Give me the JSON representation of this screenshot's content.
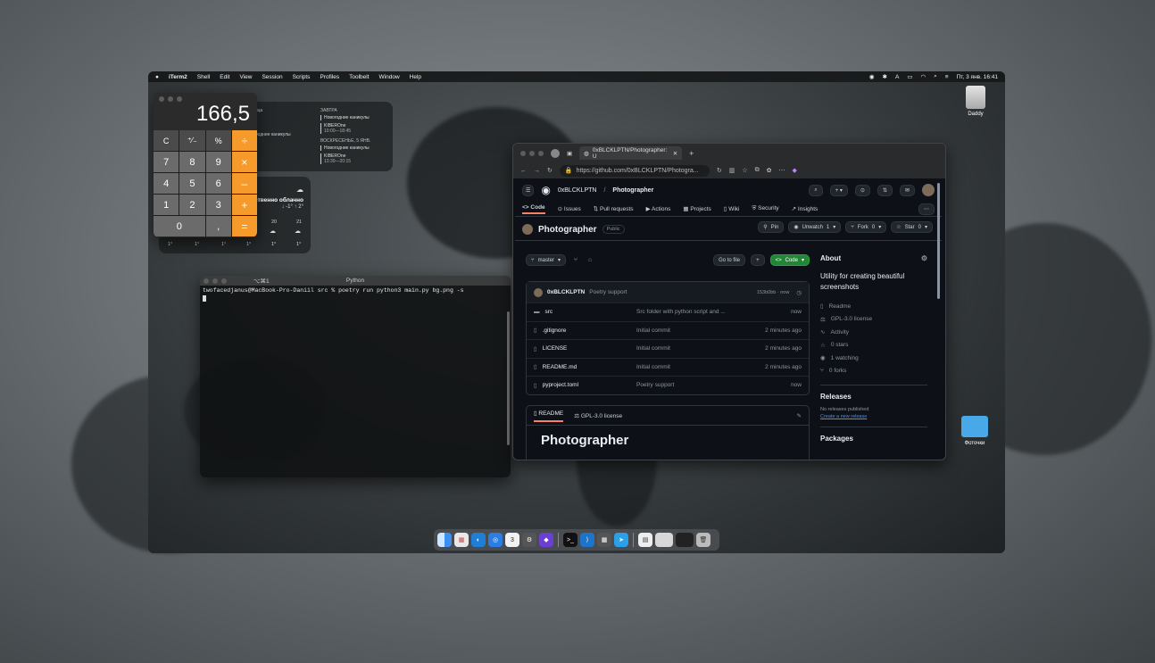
{
  "menubar": {
    "apple_icon": "apple-icon",
    "app_name": "iTerm2",
    "items": [
      "Shell",
      "Edit",
      "View",
      "Session",
      "Scripts",
      "Profiles",
      "Toolbelt",
      "Window",
      "Help"
    ],
    "clock": "Пт, 3 янв. 16:41"
  },
  "calendar_widget": {
    "partial_label": "ница",
    "partial_event": "ogодние каникулы",
    "tomorrow_label": "ЗАВТРА",
    "tomorrow_events": [
      {
        "title": "Новогодние каникулы",
        "time": ""
      },
      {
        "title": "KIBEROne",
        "time": "10:00—18:45"
      }
    ],
    "sunday_label": "ВОСКРЕСЕНЬЕ, 5 ЯНВ.",
    "sunday_events": [
      {
        "title": "Новогодние каникулы",
        "time": ""
      },
      {
        "title": "KIBEROne",
        "time": "13:30—20:15"
      }
    ]
  },
  "weather_widget": {
    "condition": "ственно облачно",
    "range": "↓ -1° ↑ 2°",
    "days": [
      "20",
      "21"
    ],
    "temps": [
      "1°",
      "1°",
      "1°",
      "1°",
      "1°",
      "1°"
    ]
  },
  "calculator": {
    "display": "166,5",
    "keys": [
      {
        "label": "C",
        "kind": "fn"
      },
      {
        "label": "⁺∕₋",
        "kind": "fn"
      },
      {
        "label": "%",
        "kind": "fn"
      },
      {
        "label": "÷",
        "kind": "op"
      },
      {
        "label": "7",
        "kind": "num"
      },
      {
        "label": "8",
        "kind": "num"
      },
      {
        "label": "9",
        "kind": "num"
      },
      {
        "label": "×",
        "kind": "op"
      },
      {
        "label": "4",
        "kind": "num"
      },
      {
        "label": "5",
        "kind": "num"
      },
      {
        "label": "6",
        "kind": "num"
      },
      {
        "label": "–",
        "kind": "op"
      },
      {
        "label": "1",
        "kind": "num"
      },
      {
        "label": "2",
        "kind": "num"
      },
      {
        "label": "3",
        "kind": "num"
      },
      {
        "label": "+",
        "kind": "op"
      },
      {
        "label": "0",
        "kind": "zero"
      },
      {
        "label": ",",
        "kind": "num"
      },
      {
        "label": "=",
        "kind": "op"
      }
    ]
  },
  "terminal": {
    "shortcut": "⌥⌘1",
    "title": "Python",
    "prompt": "twofacedjanus@MacBook-Pro-Daniil src % poetry run python3 main.py bg.png -s"
  },
  "browser": {
    "tab_title": "0xBLCKLPTN/Photographer: U",
    "url": "https://github.com/0xBLCKLPTN/Photogra..."
  },
  "github": {
    "owner": "0xBLCKLPTN",
    "repo": "Photographer",
    "nav": [
      "Code",
      "Issues",
      "Pull requests",
      "Actions",
      "Projects",
      "Wiki",
      "Security",
      "Insights"
    ],
    "visibility": "Public",
    "pin": "Pin",
    "unwatch": "Unwatch",
    "watch_count": "1",
    "fork": "Fork",
    "fork_count": "0",
    "star": "Star",
    "star_count": "0",
    "branch": "master",
    "go_to_file": "Go to file",
    "code_button": "Code",
    "commit": {
      "author": "0xBLCKLPTN",
      "message": "Poetry support",
      "hash": "153b0bb · now"
    },
    "files": [
      {
        "name": "src",
        "type": "folder",
        "message": "Src folder with python script and ...",
        "time": "now"
      },
      {
        "name": ".gitignore",
        "type": "file",
        "message": "Initial commit",
        "time": "2 minutes ago"
      },
      {
        "name": "LICENSE",
        "type": "file",
        "message": "Initial commit",
        "time": "2 minutes ago"
      },
      {
        "name": "README.md",
        "type": "file",
        "message": "Initial commit",
        "time": "2 minutes ago"
      },
      {
        "name": "pyproject.toml",
        "type": "file",
        "message": "Poetry support",
        "time": "now"
      }
    ],
    "readme_tab": "README",
    "license_tab": "GPL-3.0 license",
    "readme_heading": "Photographer",
    "about": {
      "title": "About",
      "description": "Utility for creating beautiful screenshots",
      "items": [
        "Readme",
        "GPL-3.0 license",
        "Activity",
        "0 stars",
        "1 watching",
        "0 forks"
      ],
      "releases_title": "Releases",
      "no_releases": "No releases published",
      "create_release": "Create a new release",
      "packages_title": "Packages"
    }
  },
  "desktop": {
    "disk_label": "Daddy",
    "folder_label": "Фоточки"
  },
  "colors": {
    "accent_orange": "#f69a2b",
    "github_green": "#238636",
    "link_blue": "#4493f8"
  }
}
